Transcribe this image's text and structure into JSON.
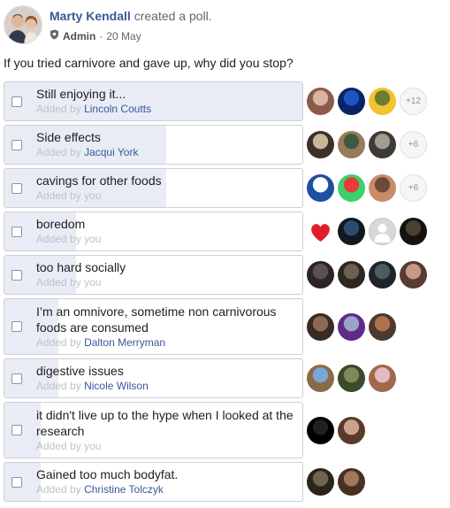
{
  "post": {
    "author": "Marty Kendall",
    "action": "created a poll.",
    "role": "Admin",
    "separator": "·",
    "date": "20 May",
    "question": "If you tried carnivore and gave up, why did you stop?"
  },
  "options": [
    {
      "label": "Still enjoying it...",
      "added_prefix": "Added by",
      "added_by": "Lincoln Coutts",
      "vote_fraction": 1.0,
      "more_count": "+12",
      "voter_colors": [
        [
          "#d9b3a3",
          "#8a5a4a"
        ],
        [
          "#1d55c4",
          "#0a2466"
        ],
        [
          "#6a7d32",
          "#f2c230"
        ]
      ]
    },
    {
      "label": "Side effects",
      "added_prefix": "Added by",
      "added_by": "Jacqui York",
      "vote_fraction": 0.54,
      "more_count": "+6",
      "voter_colors": [
        [
          "#c9b69a",
          "#3b3128"
        ],
        [
          "#3c5a3e",
          "#9a7a5a"
        ],
        [
          "#a29b92",
          "#3e3a36"
        ]
      ]
    },
    {
      "label": "cavings for other foods",
      "added_prefix": "Added by",
      "added_by": "you",
      "vote_fraction": 0.54,
      "more_count": "+6",
      "voter_colors": [
        [
          "#ffffff",
          "#1f4fa0"
        ],
        [
          "#e83b3b",
          "#3bd16b"
        ],
        [
          "#6b4a3a",
          "#c98c6a"
        ]
      ]
    },
    {
      "label": "boredom",
      "added_prefix": "Added by",
      "added_by": "you",
      "vote_fraction": 0.24,
      "more_count": "",
      "voter_colors": [
        [
          "#ffffff",
          "#e01e2b"
        ],
        [
          "#2f4a6e",
          "#101820"
        ],
        [
          "#d6d8db",
          "#ffffff"
        ],
        [
          "#4a4033",
          "#151210"
        ]
      ]
    },
    {
      "label": "too hard socially",
      "added_prefix": "Added by",
      "added_by": "you",
      "vote_fraction": 0.24,
      "more_count": "",
      "voter_colors": [
        [
          "#5a5050",
          "#2c2426"
        ],
        [
          "#6c5f54",
          "#2e2721"
        ],
        [
          "#4e5b63",
          "#1e2428"
        ],
        [
          "#c79a86",
          "#5a3b33"
        ]
      ]
    },
    {
      "label": "I’m an omnivore, sometime non carnivorous foods are consumed",
      "added_prefix": "Added by",
      "added_by": "Dalton Merryman",
      "vote_fraction": 0.18,
      "more_count": "",
      "voter_colors": [
        [
          "#8a6a55",
          "#3a2b22"
        ],
        [
          "#9aa3c8",
          "#5c2c86"
        ],
        [
          "#b07050",
          "#4a3a30"
        ]
      ]
    },
    {
      "label": "digestive issues",
      "added_prefix": "Added by",
      "added_by": "Nicole Wilson",
      "vote_fraction": 0.18,
      "more_count": "",
      "voter_colors": [
        [
          "#7aa6d8",
          "#8c6a48"
        ],
        [
          "#7e8a5a",
          "#3a4a2a"
        ],
        [
          "#e6b8c6",
          "#a06a4a"
        ]
      ]
    },
    {
      "label": "it didn't live up to the hype when I looked at the research",
      "added_prefix": "Added by",
      "added_by": "you",
      "vote_fraction": 0.12,
      "more_count": "",
      "voter_colors": [
        [
          "#202020",
          "#000000"
        ],
        [
          "#c9a28a",
          "#5a3a2a"
        ]
      ]
    },
    {
      "label": "Gained too much bodyfat.",
      "added_prefix": "Added by",
      "added_by": "Christine Tolczyk",
      "vote_fraction": 0.12,
      "more_count": "",
      "voter_colors": [
        [
          "#6e6450",
          "#2a2518"
        ],
        [
          "#a07860",
          "#4a3020"
        ]
      ]
    }
  ]
}
